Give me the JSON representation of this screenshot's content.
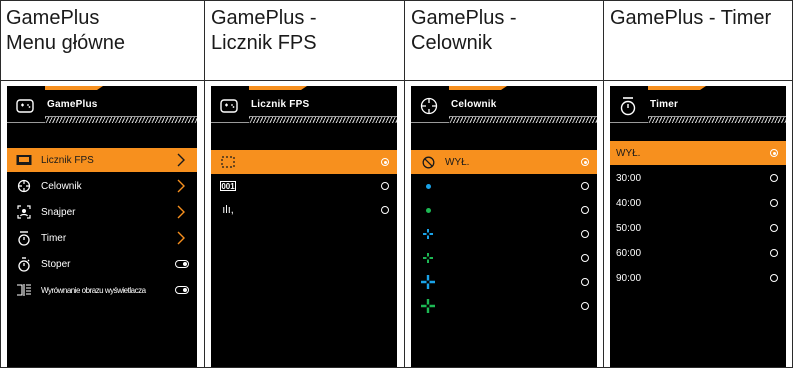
{
  "columns": [
    {
      "title_lines": [
        "GamePlus",
        "Menu główne"
      ]
    },
    {
      "title_lines": [
        "GamePlus -",
        "Licznik FPS"
      ]
    },
    {
      "title_lines": [
        "GamePlus -",
        "Celownik"
      ]
    },
    {
      "title_lines": [
        "GamePlus - Timer"
      ]
    }
  ],
  "screens": {
    "main": {
      "header": "GamePlus",
      "items": [
        {
          "label": "Licznik FPS",
          "icon": "fps-counter-icon"
        },
        {
          "label": "Celownik",
          "icon": "crosshair-icon"
        },
        {
          "label": "Snajper",
          "icon": "sniper-icon"
        },
        {
          "label": "Timer",
          "icon": "timer-icon"
        },
        {
          "label": "Stoper",
          "icon": "stopwatch-icon"
        },
        {
          "label": "Wyrównanie obrazu wyświetlacza",
          "icon": "display-alignment-icon"
        }
      ]
    },
    "fps": {
      "header": "Licznik FPS",
      "options": [
        {
          "icon": "fps-frame-icon",
          "text": ""
        },
        {
          "icon": "fps-number-icon",
          "text": "001"
        },
        {
          "icon": "fps-graph-icon",
          "text": "ılı,"
        }
      ]
    },
    "crosshair": {
      "header": "Celownik",
      "off_label": "WYŁ.",
      "options": [
        "off",
        "blue-dot",
        "green-dot",
        "blue-small-cross",
        "green-small-cross",
        "blue-large-cross",
        "green-large-cross"
      ]
    },
    "timer": {
      "header": "Timer",
      "options": [
        "WYŁ.",
        "30:00",
        "40:00",
        "50:00",
        "60:00",
        "90:00"
      ]
    }
  },
  "colors": {
    "accent": "#f7901e",
    "screen_bg": "#000000",
    "blue": "#1aa3e8",
    "green": "#1db954"
  }
}
